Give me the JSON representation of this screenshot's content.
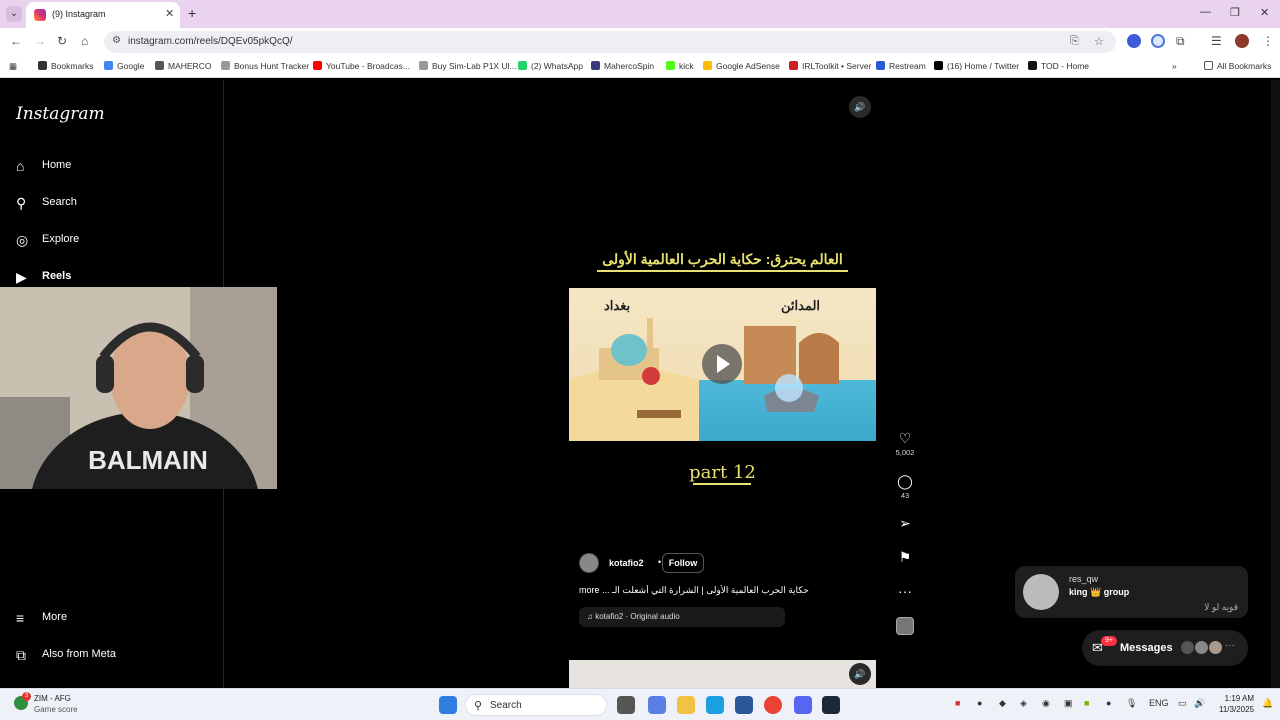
{
  "browser": {
    "tab_title": "(9) Instagram",
    "url": "instagram.com/reels/DQEv05pkQcQ/",
    "bookmarks": [
      {
        "label": "Bookmarks",
        "color": "#333333"
      },
      {
        "label": "Google",
        "color": "#4285f4"
      },
      {
        "label": "MAHERCO",
        "color": "#555555"
      },
      {
        "label": "Bonus Hunt Tracker",
        "color": "#999999"
      },
      {
        "label": "YouTube - Broadcas...",
        "color": "#ff0000"
      },
      {
        "label": "Buy Sim-Lab P1X Ul...",
        "color": "#999999"
      },
      {
        "label": "(2) WhatsApp",
        "color": "#25d366"
      },
      {
        "label": "MahercoSpin",
        "color": "#3a3a7a"
      },
      {
        "label": "kick",
        "color": "#53fc18"
      },
      {
        "label": "Google AdSense",
        "color": "#fbbc04"
      },
      {
        "label": "IRLToolkit • Server",
        "color": "#cc2222"
      },
      {
        "label": "Restream",
        "color": "#2a5bd7"
      },
      {
        "label": "(16) Home / Twitter",
        "color": "#000000"
      },
      {
        "label": "TOD - Home",
        "color": "#111111"
      }
    ],
    "all_bookmarks": "All Bookmarks"
  },
  "sidebar": {
    "logo": "Instagram",
    "items": [
      {
        "label": "Home",
        "icon": "⌂"
      },
      {
        "label": "Search",
        "icon": "⚲"
      },
      {
        "label": "Explore",
        "icon": "◎"
      },
      {
        "label": "Reels",
        "icon": "▶"
      },
      {
        "label": "More",
        "icon": "≡"
      },
      {
        "label": "Also from Meta",
        "icon": "⧉"
      }
    ]
  },
  "reel": {
    "title_ar": "العالم يحترق: حكاية الحرب العالمية الأولى",
    "label_left": "بغداد",
    "label_right": "المدائن",
    "part": "part 12",
    "author": "kotafio2",
    "follow": "Follow",
    "caption": "more ... حكاية الحرب العالمية الأولى | الشرارة التي أشعلت الـ",
    "audio": "kotafio2 · Original audio",
    "likes": "5,002",
    "comments": "43"
  },
  "notification": {
    "name": "res_qw",
    "group": "king 👑 group",
    "message": "قويه لو لا"
  },
  "messages": {
    "label": "Messages",
    "badge": "9+"
  },
  "taskbar": {
    "weather_title": "ZIM - AFG",
    "weather_sub": "Game score",
    "weather_badge": "3",
    "search_label": "Search",
    "lang": "ENG",
    "time": "1:19 AM",
    "date": "11/3/2025"
  }
}
